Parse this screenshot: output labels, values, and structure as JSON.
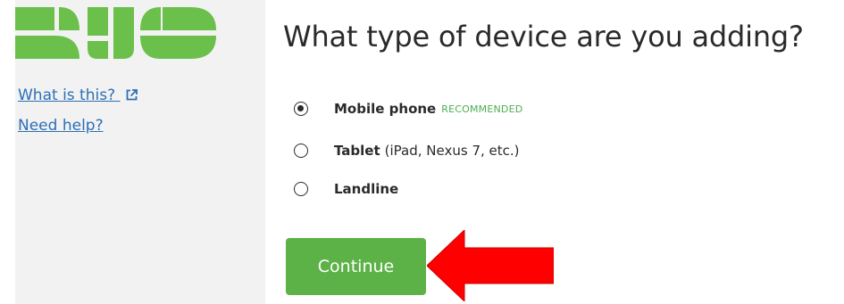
{
  "sidebar": {
    "logo_icon": "duo-logo",
    "brand_color": "#6bc04b",
    "links": [
      {
        "label": "What is this?",
        "icon": "external-link-icon"
      },
      {
        "label": "Need help?"
      }
    ]
  },
  "main": {
    "heading": "What type of device are you adding?",
    "options": [
      {
        "name": "Mobile phone",
        "detail": "",
        "badge": "RECOMMENDED",
        "checked": true
      },
      {
        "name": "Tablet",
        "detail": "(iPad, Nexus 7, etc.)",
        "badge": "",
        "checked": false
      },
      {
        "name": "Landline",
        "detail": "",
        "badge": "",
        "checked": false
      }
    ],
    "continue_label": "Continue",
    "button_color": "#5cb246"
  },
  "annotation": {
    "arrow_icon": "red-arrow-icon",
    "arrow_color": "#ff0000"
  }
}
